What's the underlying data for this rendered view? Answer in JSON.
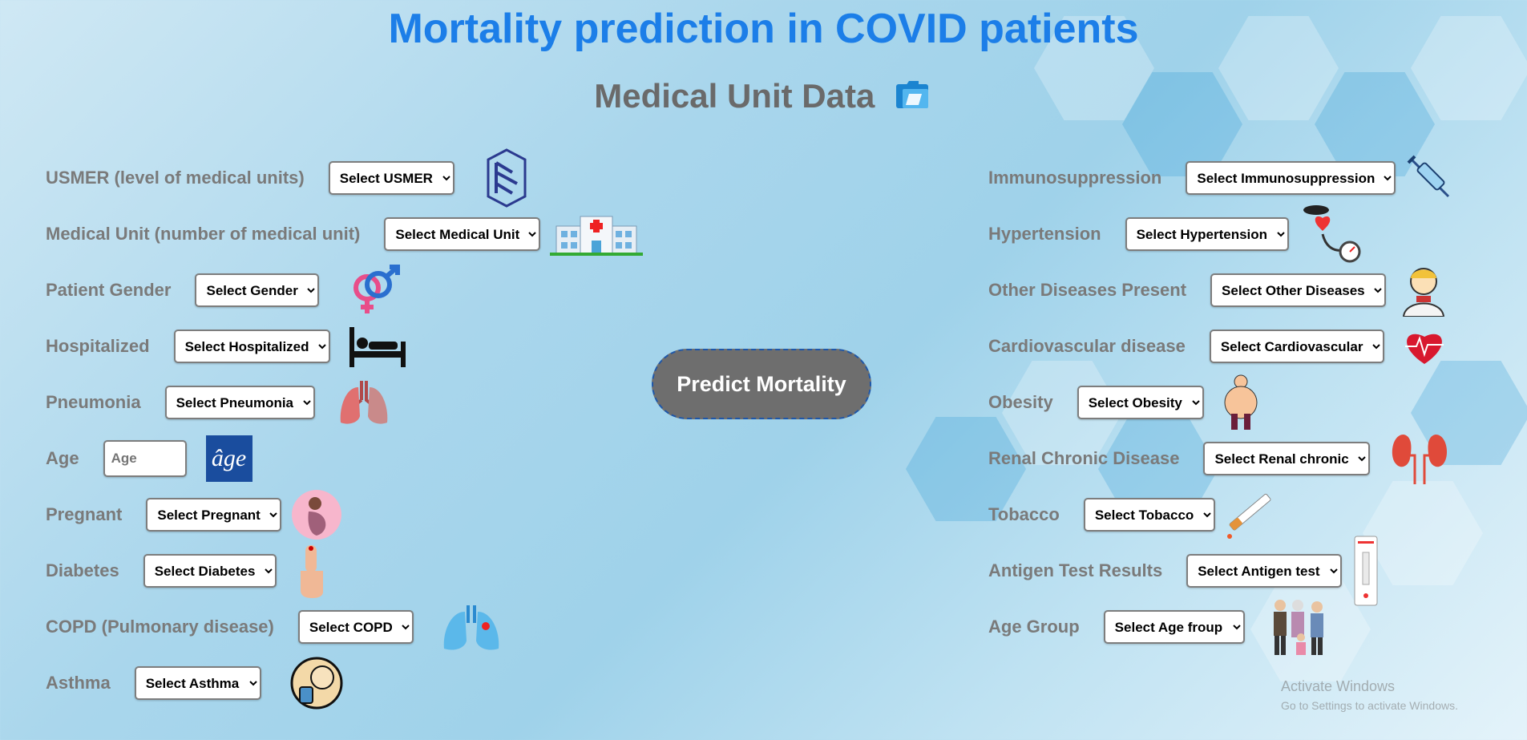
{
  "header": {
    "title": "Mortality prediction in COVID patients",
    "subtitle": "Medical Unit Data",
    "subtitle_icon": "folder-icon"
  },
  "left_fields": [
    {
      "label": "USMER (level of medical units)",
      "select": "Select USMER",
      "icon": "staircase-icon"
    },
    {
      "label": "Medical Unit (number of medical unit)",
      "select": "Select Medical Unit",
      "icon": "hospital-icon"
    },
    {
      "label": "Patient Gender",
      "select": "Select Gender",
      "icon": "gender-icon"
    },
    {
      "label": "Hospitalized",
      "select": "Select Hospitalized",
      "icon": "hospital-bed-icon"
    },
    {
      "label": "Pneumonia",
      "select": "Select Pneumonia",
      "icon": "lungs-icon"
    },
    {
      "label": "Age",
      "placeholder": "Age",
      "icon": "age-icon",
      "icon_text": "âge"
    },
    {
      "label": "Pregnant",
      "select": "Select Pregnant",
      "icon": "pregnant-icon"
    },
    {
      "label": "Diabetes",
      "select": "Select Diabetes",
      "icon": "finger-prick-icon"
    },
    {
      "label": "COPD (Pulmonary disease)",
      "select": "Select COPD",
      "icon": "lungs-blue-icon"
    },
    {
      "label": "Asthma",
      "select": "Select Asthma",
      "icon": "inhaler-icon"
    }
  ],
  "right_fields": [
    {
      "label": "Immunosuppression",
      "select": "Select Immunosuppression",
      "icon": "syringe-icon"
    },
    {
      "label": "Hypertension",
      "select": "Select Hypertension",
      "icon": "blood-pressure-icon"
    },
    {
      "label": "Other Diseases Present",
      "select": "Select Other Diseases",
      "icon": "sick-person-icon"
    },
    {
      "label": "Cardiovascular disease",
      "select": "Select Cardiovascular",
      "icon": "heart-icon"
    },
    {
      "label": "Obesity",
      "select": "Select Obesity",
      "icon": "obese-person-icon"
    },
    {
      "label": "Renal Chronic Disease",
      "select": "Select Renal chronic",
      "icon": "kidneys-icon"
    },
    {
      "label": "Tobacco",
      "select": "Select Tobacco",
      "icon": "cigarette-icon"
    },
    {
      "label": "Antigen Test Results",
      "select": "Select Antigen test",
      "icon": "test-strip-icon"
    },
    {
      "label": "Age Group",
      "select": "Select Age froup",
      "icon": "family-icon"
    }
  ],
  "predict_button": "Predict Mortality",
  "watermark": {
    "title": "Activate Windows",
    "subtitle": "Go to Settings to activate Windows."
  },
  "colors": {
    "title": "#1c7ee8",
    "label": "#7a7a7a",
    "button": "#6e6e6e",
    "button_border": "#1f57a8"
  }
}
